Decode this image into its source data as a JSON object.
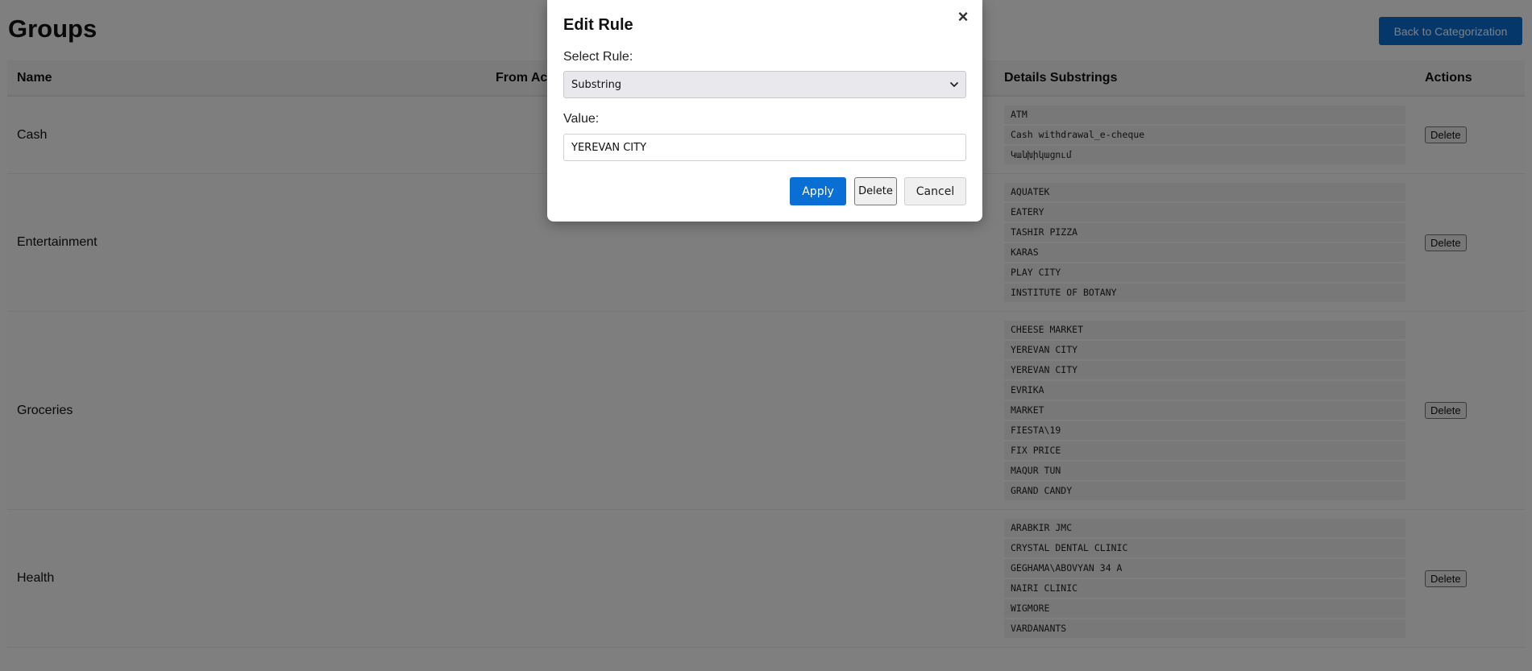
{
  "page": {
    "title": "Groups",
    "back_button": "Back to Categorization"
  },
  "table": {
    "headers": {
      "name": "Name",
      "from_account": "From Account",
      "details": "Details Substrings",
      "actions": "Actions"
    },
    "rows": [
      {
        "name": "Cash",
        "substrings": [
          "ATM",
          "Cash withdrawal_e-cheque",
          "Կանխիկացում"
        ],
        "delete_label": "Delete"
      },
      {
        "name": "Entertainment",
        "substrings": [
          "AQUATEK",
          "EATERY",
          "TASHIR PIZZA",
          "KARAS",
          "PLAY CITY",
          "INSTITUTE OF BOTANY"
        ],
        "delete_label": "Delete"
      },
      {
        "name": "Groceries",
        "substrings": [
          "CHEESE MARKET",
          "YEREVAN CITY",
          "YEREVAN CITY",
          "EVRIKA",
          "MARKET",
          "FIESTA\\19",
          "FIX PRICE",
          "MAQUR TUN",
          "GRAND CANDY"
        ],
        "delete_label": "Delete"
      },
      {
        "name": "Health",
        "substrings": [
          "ARABKIR JMC",
          "CRYSTAL DENTAL CLINIC",
          "GEGHAMA\\ABOVYAN 34 A",
          "NAIRI CLINIC",
          "WIGMORE",
          "VARDANANTS"
        ],
        "delete_label": "Delete"
      }
    ]
  },
  "modal": {
    "title": "Edit Rule",
    "close_glyph": "×",
    "select_label": "Select Rule:",
    "selected_rule": "Substring",
    "value_label": "Value:",
    "value": "YEREVAN CITY",
    "apply_label": "Apply",
    "delete_label": "Delete",
    "cancel_label": "Cancel"
  },
  "colors": {
    "primary": "#0a6fd4",
    "overlay": "rgba(0,0,0,0.5)"
  }
}
